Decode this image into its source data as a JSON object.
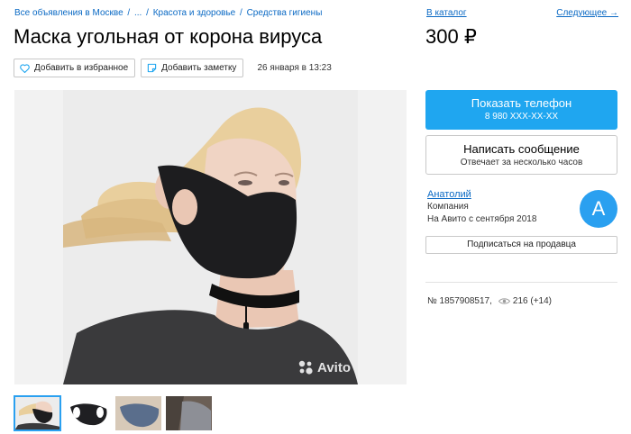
{
  "breadcrumb": {
    "items": [
      "Все объявления в Москве",
      "...",
      "Красота и здоровье",
      "Средства гигиены"
    ]
  },
  "title": "Маска угольная от корона вируса",
  "price": "300 ₽",
  "nav": {
    "catalog": "В каталог",
    "next": "Следующее →"
  },
  "toolbar": {
    "favorite_label": "Добавить в избранное",
    "note_label": "Добавить заметку",
    "timestamp": "26 января в 13:23"
  },
  "gallery": {
    "watermark": "Avito",
    "thumbnail_count": 4
  },
  "contact": {
    "phone_title": "Показать телефон",
    "phone_number": "8 980 XXX-XX-XX",
    "message_title": "Написать сообщение",
    "message_subtitle": "Отвечает за несколько часов"
  },
  "seller": {
    "name": "Анатолий",
    "type": "Компания",
    "since": "На Авито с сентября 2018",
    "avatar_letter": "A",
    "subscribe_label": "Подписаться на продавца"
  },
  "meta": {
    "item_number": "№ 1857908517,",
    "views": "216 (+14)"
  },
  "colors": {
    "link": "#0a69c4",
    "accent": "#1fa6f0",
    "avatar": "#2aa0f0"
  }
}
